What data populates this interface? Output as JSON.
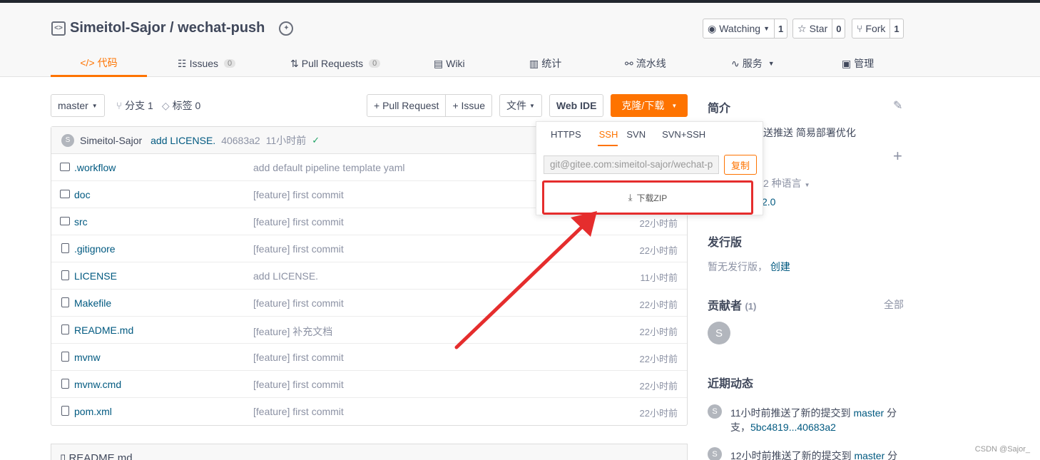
{
  "repo": {
    "owner_repo": "Simeitol-Sajor / wechat-push"
  },
  "actions": [
    {
      "label": "Watching",
      "count": "1"
    },
    {
      "label": "Star",
      "count": "0"
    },
    {
      "label": "Fork",
      "count": "1"
    }
  ],
  "tabs": [
    {
      "label": "代码",
      "count": ""
    },
    {
      "label": "Issues",
      "count": "0"
    },
    {
      "label": "Pull Requests",
      "count": "0"
    },
    {
      "label": "Wiki",
      "count": ""
    },
    {
      "label": "统计",
      "count": ""
    },
    {
      "label": "流水线",
      "count": ""
    },
    {
      "label": "服务",
      "count": ""
    },
    {
      "label": "管理",
      "count": ""
    }
  ],
  "toolbar": {
    "branch": "master",
    "branches": "分支 1",
    "tags": "标签 0",
    "pull_request": "+ Pull Request",
    "issue": "+ Issue",
    "files": "文件",
    "web_ide": "Web IDE",
    "clone": "克隆/下载"
  },
  "commit": {
    "avatar": "S",
    "author": "Simeitol-Sajor",
    "message": "add LICENSE.",
    "hash": "40683a2",
    "time": "11小时前"
  },
  "files": [
    {
      "name": ".workflow",
      "type": "dir",
      "message": "add default pipeline template yaml",
      "time": ""
    },
    {
      "name": "doc",
      "type": "dir",
      "message": "[feature] first commit",
      "time": ""
    },
    {
      "name": "src",
      "type": "dir",
      "message": "[feature] first commit",
      "time": "22小时前"
    },
    {
      "name": ".gitignore",
      "type": "file",
      "message": "[feature] first commit",
      "time": "22小时前"
    },
    {
      "name": "LICENSE",
      "type": "file",
      "message": "add LICENSE.",
      "time": "11小时前"
    },
    {
      "name": "Makefile",
      "type": "file",
      "message": "[feature] first commit",
      "time": "22小时前"
    },
    {
      "name": "README.md",
      "type": "file",
      "message": "[feature] 补充文档",
      "time": "22小时前"
    },
    {
      "name": "mvnw",
      "type": "file",
      "message": "[feature] first commit",
      "time": "22小时前"
    },
    {
      "name": "mvnw.cmd",
      "type": "file",
      "message": "[feature] first commit",
      "time": "22小时前"
    },
    {
      "name": "pom.xml",
      "type": "file",
      "message": "[feature] first commit",
      "time": "22小时前"
    }
  ],
  "readme_title": "README.md",
  "clone_popup": {
    "tabs": [
      "HTTPS",
      "SSH",
      "SVN",
      "SVN+SSH"
    ],
    "active_tab": "SSH",
    "url": "git@gitee.com:simeitol-sajor/wechat-p",
    "copy": "复制",
    "zip": "下载ZIP"
  },
  "sidebar": {
    "intro_title": "简介",
    "intro_text": "送推送 简易部署优化",
    "languages": "2 种语言",
    "license": "2.0",
    "release_title": "发行版",
    "release_empty": "暂无发行版，",
    "release_create": "创建",
    "contributors_title": "贡献者",
    "contributors_count": "(1)",
    "contributors_all": "全部",
    "contributor_avatar": "S",
    "activity_title": "近期动态",
    "activity": [
      {
        "avatar": "S",
        "text": "11小时前推送了新的提交到",
        "branch": "master",
        "suffix": "分支，",
        "range": "5bc4819...40683a2"
      },
      {
        "avatar": "S",
        "text": "12小时前推送了新的提交到",
        "branch": "master",
        "suffix": "分",
        "range": ""
      }
    ]
  },
  "watermark": "CSDN @Sajor_",
  "colors": {
    "accent": "#fe7300",
    "link": "#005980",
    "highlight": "#e52d2d"
  }
}
